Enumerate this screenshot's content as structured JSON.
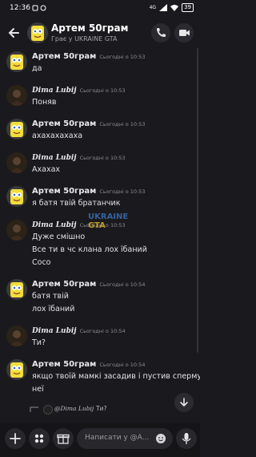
{
  "status": {
    "time": "12:36",
    "network": "4G",
    "battery": "39"
  },
  "header": {
    "title": "Артем 50грам",
    "subtitle": "Грає у UKRAINE GTA"
  },
  "watermark": {
    "line1": "UKRAINE",
    "line2": "GTA"
  },
  "messages": [
    {
      "author": "Артем 50грам",
      "author_style": "bold",
      "time": "Сьогодні о 10:53",
      "lines": [
        "да"
      ],
      "avatar": "spongebob"
    },
    {
      "author": "Dima Lubij",
      "author_style": "script",
      "time": "Сьогодні о 10:53",
      "lines": [
        "Поняв"
      ],
      "avatar": "dark"
    },
    {
      "author": "Артем 50грам",
      "author_style": "bold",
      "time": "Сьогодні о 10:53",
      "lines": [
        "ахахахахаха"
      ],
      "avatar": "spongebob"
    },
    {
      "author": "Dima Lubij",
      "author_style": "script",
      "time": "Сьогодні о 10:53",
      "lines": [
        "Ахахах"
      ],
      "avatar": "dark"
    },
    {
      "author": "Артем 50грам",
      "author_style": "bold",
      "time": "Сьогодні о 10:53",
      "lines": [
        "я батя твій братанчик"
      ],
      "avatar": "spongebob"
    },
    {
      "author": "Dima Lubij",
      "author_style": "script",
      "time": "Сьогодні о 10:53",
      "lines": [
        "Дуже смішно",
        "Все ти в чс клана лох їбаний",
        "Сосо"
      ],
      "avatar": "dark"
    },
    {
      "author": "Артем 50грам",
      "author_style": "bold",
      "time": "Сьогодні о 10:54",
      "lines": [
        "батя твій",
        "лох їбаний"
      ],
      "avatar": "spongebob"
    },
    {
      "author": "Dima Lubij",
      "author_style": "script",
      "time": "Сьогодні о 10:54",
      "lines": [
        "Ти?"
      ],
      "avatar": "dark"
    },
    {
      "author": "Артем 50грам",
      "author_style": "bold",
      "time": "Сьогодні о 10:54",
      "lines": [
        "якщо твоїй мамкі засадив і пустив сперму в",
        "неї"
      ],
      "avatar": "spongebob"
    }
  ],
  "reply_preview": {
    "author": "@Dima Lubij",
    "text": "Ти?"
  },
  "composer": {
    "placeholder": "Написати у @А..."
  },
  "colors": {
    "background": "#1a1a1e",
    "spongebob": "#f2dd3c",
    "accent": "#5865f2"
  },
  "icons": [
    "back-arrow-icon",
    "call-icon",
    "video-call-icon",
    "plus-icon",
    "apps-icon",
    "gift-icon",
    "emoji-icon",
    "mic-icon",
    "chevron-down-icon"
  ]
}
